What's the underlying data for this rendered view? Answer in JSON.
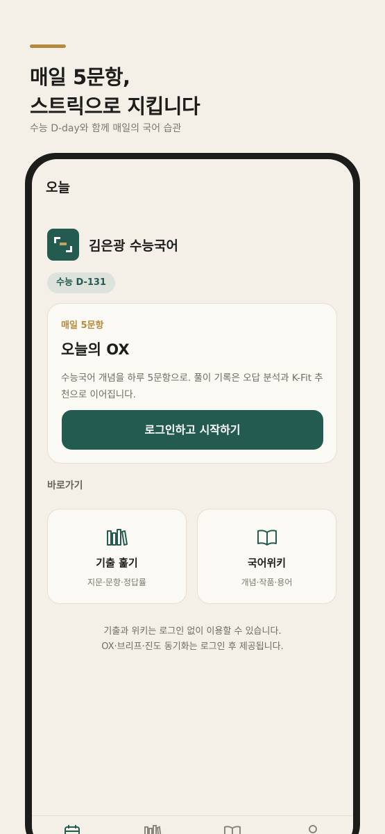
{
  "hero": {
    "title_line1": "매일 5문항,",
    "title_line2": "스트릭으로 지킵니다",
    "subtitle": "수능 D-day와 함께 매일의 국어 습관"
  },
  "screen": {
    "title": "오늘",
    "brand_name": "김은광 수능국어",
    "dday_badge": "수능 D-131"
  },
  "daily_card": {
    "eyebrow": "매일 5문항",
    "title": "오늘의 OX",
    "description": "수능국어 개념을 하루 5문항으로. 풀이 기록은 오답 분석과 K-Fit 추천으로 이어집니다.",
    "button_label": "로그인하고 시작하기"
  },
  "shortcuts": {
    "label": "바로가기",
    "items": [
      {
        "title": "기출 훑기",
        "subtitle": "지문·문항·정답률",
        "icon": "bookshelf-icon"
      },
      {
        "title": "국어위키",
        "subtitle": "개념·작품·용어",
        "icon": "open-book-icon"
      }
    ]
  },
  "footnote": {
    "line1": "기출과 위키는 로그인 없이 이용할 수 있습니다.",
    "line2": "OX·브리프·진도 동기화는 로그인 후 제공됩니다."
  },
  "tabbar": {
    "icons": [
      "calendar-icon",
      "bookshelf-icon",
      "open-book-icon",
      "person-icon"
    ]
  },
  "colors": {
    "background": "#f4f0e7",
    "primary": "#245b50",
    "accent": "#b48a3c",
    "card": "#fbf9f3"
  }
}
